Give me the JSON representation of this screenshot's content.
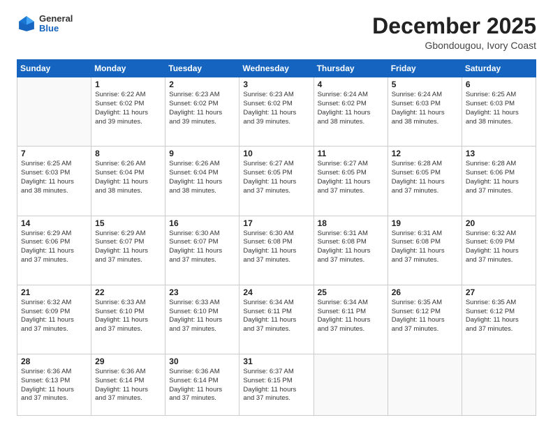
{
  "header": {
    "logo": {
      "general": "General",
      "blue": "Blue"
    },
    "title": "December 2025",
    "subtitle": "Gbondougou, Ivory Coast"
  },
  "calendar": {
    "days": [
      "Sunday",
      "Monday",
      "Tuesday",
      "Wednesday",
      "Thursday",
      "Friday",
      "Saturday"
    ],
    "weeks": [
      [
        {
          "day": "",
          "text": ""
        },
        {
          "day": "1",
          "text": "Sunrise: 6:22 AM\nSunset: 6:02 PM\nDaylight: 11 hours\nand 39 minutes."
        },
        {
          "day": "2",
          "text": "Sunrise: 6:23 AM\nSunset: 6:02 PM\nDaylight: 11 hours\nand 39 minutes."
        },
        {
          "day": "3",
          "text": "Sunrise: 6:23 AM\nSunset: 6:02 PM\nDaylight: 11 hours\nand 39 minutes."
        },
        {
          "day": "4",
          "text": "Sunrise: 6:24 AM\nSunset: 6:02 PM\nDaylight: 11 hours\nand 38 minutes."
        },
        {
          "day": "5",
          "text": "Sunrise: 6:24 AM\nSunset: 6:03 PM\nDaylight: 11 hours\nand 38 minutes."
        },
        {
          "day": "6",
          "text": "Sunrise: 6:25 AM\nSunset: 6:03 PM\nDaylight: 11 hours\nand 38 minutes."
        }
      ],
      [
        {
          "day": "7",
          "text": "Sunrise: 6:25 AM\nSunset: 6:03 PM\nDaylight: 11 hours\nand 38 minutes."
        },
        {
          "day": "8",
          "text": "Sunrise: 6:26 AM\nSunset: 6:04 PM\nDaylight: 11 hours\nand 38 minutes."
        },
        {
          "day": "9",
          "text": "Sunrise: 6:26 AM\nSunset: 6:04 PM\nDaylight: 11 hours\nand 38 minutes."
        },
        {
          "day": "10",
          "text": "Sunrise: 6:27 AM\nSunset: 6:05 PM\nDaylight: 11 hours\nand 37 minutes."
        },
        {
          "day": "11",
          "text": "Sunrise: 6:27 AM\nSunset: 6:05 PM\nDaylight: 11 hours\nand 37 minutes."
        },
        {
          "day": "12",
          "text": "Sunrise: 6:28 AM\nSunset: 6:05 PM\nDaylight: 11 hours\nand 37 minutes."
        },
        {
          "day": "13",
          "text": "Sunrise: 6:28 AM\nSunset: 6:06 PM\nDaylight: 11 hours\nand 37 minutes."
        }
      ],
      [
        {
          "day": "14",
          "text": "Sunrise: 6:29 AM\nSunset: 6:06 PM\nDaylight: 11 hours\nand 37 minutes."
        },
        {
          "day": "15",
          "text": "Sunrise: 6:29 AM\nSunset: 6:07 PM\nDaylight: 11 hours\nand 37 minutes."
        },
        {
          "day": "16",
          "text": "Sunrise: 6:30 AM\nSunset: 6:07 PM\nDaylight: 11 hours\nand 37 minutes."
        },
        {
          "day": "17",
          "text": "Sunrise: 6:30 AM\nSunset: 6:08 PM\nDaylight: 11 hours\nand 37 minutes."
        },
        {
          "day": "18",
          "text": "Sunrise: 6:31 AM\nSunset: 6:08 PM\nDaylight: 11 hours\nand 37 minutes."
        },
        {
          "day": "19",
          "text": "Sunrise: 6:31 AM\nSunset: 6:08 PM\nDaylight: 11 hours\nand 37 minutes."
        },
        {
          "day": "20",
          "text": "Sunrise: 6:32 AM\nSunset: 6:09 PM\nDaylight: 11 hours\nand 37 minutes."
        }
      ],
      [
        {
          "day": "21",
          "text": "Sunrise: 6:32 AM\nSunset: 6:09 PM\nDaylight: 11 hours\nand 37 minutes."
        },
        {
          "day": "22",
          "text": "Sunrise: 6:33 AM\nSunset: 6:10 PM\nDaylight: 11 hours\nand 37 minutes."
        },
        {
          "day": "23",
          "text": "Sunrise: 6:33 AM\nSunset: 6:10 PM\nDaylight: 11 hours\nand 37 minutes."
        },
        {
          "day": "24",
          "text": "Sunrise: 6:34 AM\nSunset: 6:11 PM\nDaylight: 11 hours\nand 37 minutes."
        },
        {
          "day": "25",
          "text": "Sunrise: 6:34 AM\nSunset: 6:11 PM\nDaylight: 11 hours\nand 37 minutes."
        },
        {
          "day": "26",
          "text": "Sunrise: 6:35 AM\nSunset: 6:12 PM\nDaylight: 11 hours\nand 37 minutes."
        },
        {
          "day": "27",
          "text": "Sunrise: 6:35 AM\nSunset: 6:12 PM\nDaylight: 11 hours\nand 37 minutes."
        }
      ],
      [
        {
          "day": "28",
          "text": "Sunrise: 6:36 AM\nSunset: 6:13 PM\nDaylight: 11 hours\nand 37 minutes."
        },
        {
          "day": "29",
          "text": "Sunrise: 6:36 AM\nSunset: 6:14 PM\nDaylight: 11 hours\nand 37 minutes."
        },
        {
          "day": "30",
          "text": "Sunrise: 6:36 AM\nSunset: 6:14 PM\nDaylight: 11 hours\nand 37 minutes."
        },
        {
          "day": "31",
          "text": "Sunrise: 6:37 AM\nSunset: 6:15 PM\nDaylight: 11 hours\nand 37 minutes."
        },
        {
          "day": "",
          "text": ""
        },
        {
          "day": "",
          "text": ""
        },
        {
          "day": "",
          "text": ""
        }
      ]
    ]
  }
}
